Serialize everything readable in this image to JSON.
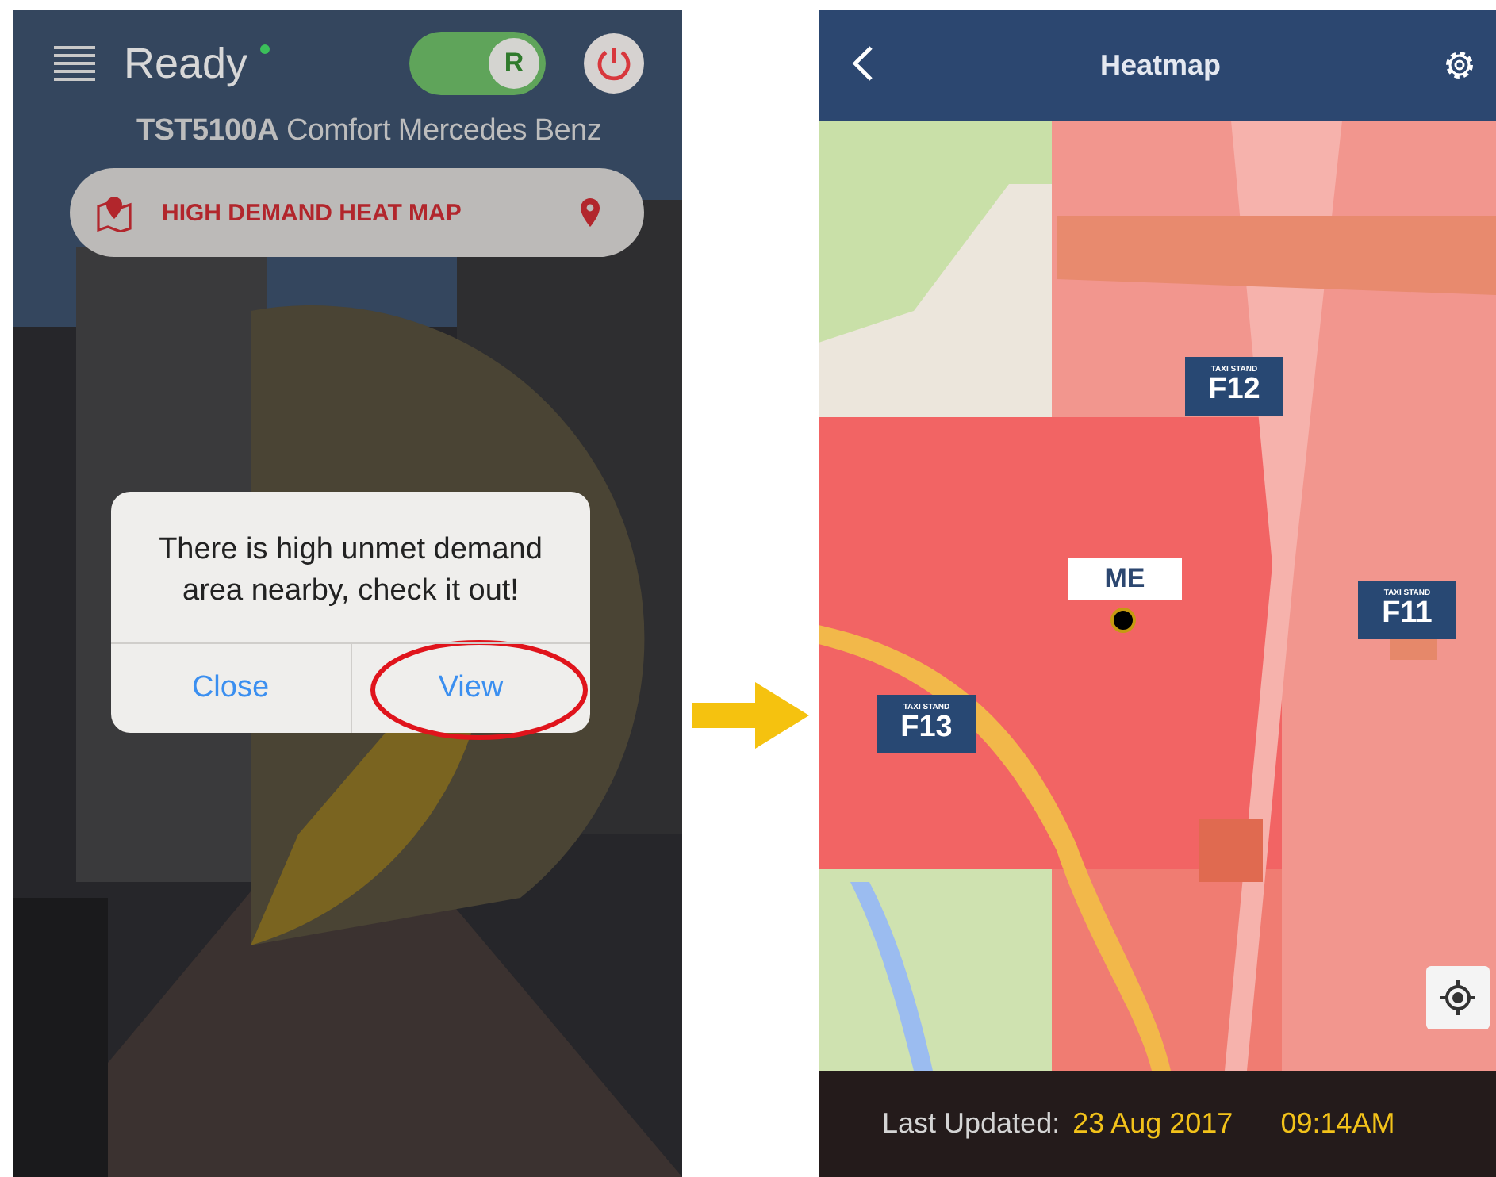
{
  "left_screen": {
    "status": {
      "label": "Ready",
      "online": true
    },
    "mode_toggle": {
      "label": "R",
      "on": true
    },
    "vehicle": {
      "plate": "TST5100A",
      "model": "Comfort Mercedes Benz"
    },
    "heatmap_button": {
      "label": "HIGH DEMAND HEAT MAP"
    },
    "alert": {
      "message": "There is high unmet demand area nearby, check it out!",
      "buttons": [
        {
          "label": "Close",
          "highlighted": false
        },
        {
          "label": "View",
          "highlighted": true
        }
      ]
    }
  },
  "right_screen": {
    "header": {
      "title": "Heatmap"
    },
    "me_marker": {
      "label": "ME"
    },
    "taxi_stands": [
      {
        "caption": "TAXI STAND",
        "code": "F12"
      },
      {
        "caption": "TAXI STAND",
        "code": "F11"
      },
      {
        "caption": "TAXI STAND",
        "code": "F13"
      }
    ],
    "footer": {
      "label": "Last Updated:",
      "date": "23 Aug 2017",
      "time": "09:14AM"
    }
  }
}
